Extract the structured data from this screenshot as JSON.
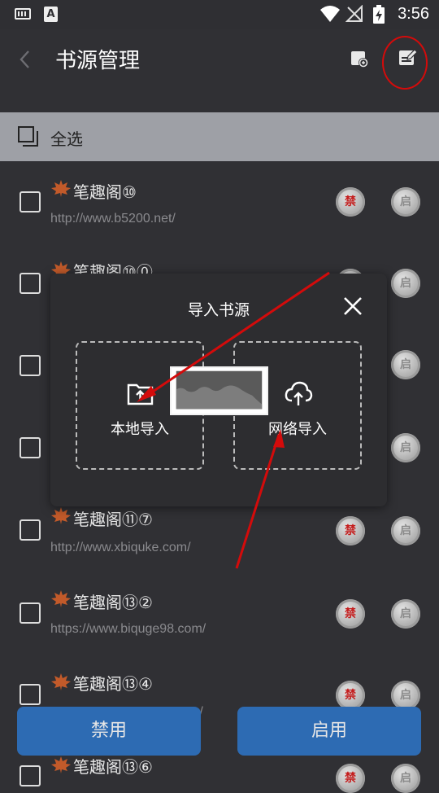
{
  "status_bar": {
    "time": "3:56",
    "app_icon_letter": "A"
  },
  "header": {
    "title": "书源管理",
    "icons": [
      "back-icon",
      "import-icon",
      "edit-icon"
    ]
  },
  "select_all": {
    "label": "全选"
  },
  "sources": [
    {
      "name": "笔趣阁⑩",
      "url": "http://www.b5200.net/",
      "disable_badge": "禁",
      "enable_badge": "启"
    },
    {
      "name": "笔趣阁⑩⓪",
      "url": "",
      "disable_badge": "禁",
      "enable_badge": "启"
    },
    {
      "name": "",
      "url": "",
      "disable_badge": "",
      "enable_badge": "启"
    },
    {
      "name": "",
      "url": "",
      "disable_badge": "",
      "enable_badge": "启"
    },
    {
      "name": "笔趣阁⑪⑦",
      "url": "http://www.xbiquke.com/",
      "disable_badge": "禁",
      "enable_badge": "启"
    },
    {
      "name": "笔趣阁⑬②",
      "url": "https://www.biquge98.com/",
      "disable_badge": "禁",
      "enable_badge": "启"
    },
    {
      "name": "笔趣阁⑬④",
      "url": "m/",
      "disable_badge": "禁",
      "enable_badge": "启"
    },
    {
      "name": "笔趣阁⑬⑥",
      "url": "",
      "disable_badge": "禁",
      "enable_badge": "启"
    }
  ],
  "dialog": {
    "title": "导入书源",
    "local_import": "本地导入",
    "network_import": "网络导入"
  },
  "footer": {
    "disable_label": "禁用",
    "enable_label": "启用"
  },
  "colors": {
    "accent": "#2d6bb3",
    "annotation": "#d30b0b",
    "ban_text": "#c41d1d"
  }
}
